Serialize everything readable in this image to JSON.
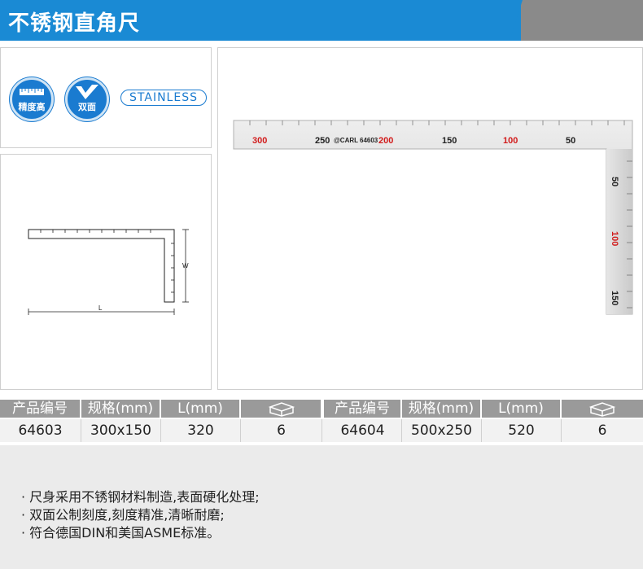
{
  "header": {
    "title": "不锈钢直角尺"
  },
  "badges": [
    {
      "label": "精度高",
      "icon": "ruler-icon"
    },
    {
      "label": "双面",
      "icon": "checkmark-icon"
    }
  ],
  "stainless_label": "STAINLESS",
  "diagram": {
    "w_label": "W",
    "l_label": "L"
  },
  "photo_ruler": {
    "top_numbers": [
      "300",
      "250",
      "@CARL",
      "64603",
      "200",
      "150",
      "100",
      "50"
    ],
    "side_numbers": [
      "50",
      "100",
      "150"
    ]
  },
  "table_left": {
    "headers": [
      "产品编号",
      "规格(mm)",
      "L(mm)",
      "box-icon"
    ],
    "row": [
      "64603",
      "300x150",
      "320",
      "6"
    ]
  },
  "table_right": {
    "headers": [
      "产品编号",
      "规格(mm)",
      "L(mm)",
      "box-icon"
    ],
    "row": [
      "64604",
      "500x250",
      "520",
      "6"
    ]
  },
  "features": [
    "· 尺身采用不锈钢材料制造,表面硬化处理;",
    "· 双面公制刻度,刻度精准,清晰耐磨;",
    "· 符合德国DIN和美国ASME标准。"
  ],
  "colors": {
    "accent": "#1a8ad4",
    "header_grey": "#9a9a9a",
    "red_marks": "#d11a1a"
  }
}
